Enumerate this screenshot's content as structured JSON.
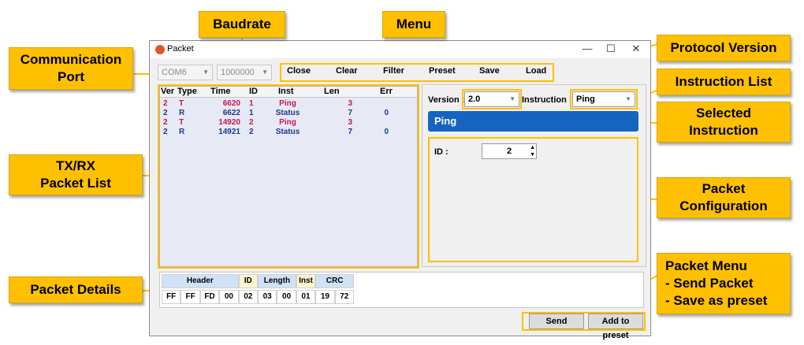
{
  "callouts": {
    "comm_port": "Communication\nPort",
    "baudrate": "Baudrate",
    "menu": "Menu",
    "protocol_version": "Protocol Version",
    "instruction_list": "Instruction List",
    "selected_instruction": "Selected\nInstruction",
    "txrx_list": "TX/RX\nPacket List",
    "packet_configuration": "Packet\nConfiguration",
    "packet_details": "Packet Details",
    "packet_menu": "Packet Menu\n - Send Packet\n - Save as preset"
  },
  "window": {
    "title": "Packet",
    "minimize": "—",
    "maximize": "☐",
    "close": "✕"
  },
  "toolbar": {
    "port": "COM6",
    "baud": "1000000",
    "menu": [
      "Close",
      "Clear",
      "Filter",
      "Preset",
      "Save",
      "Load"
    ]
  },
  "packet_list": {
    "columns": [
      "Ver",
      "Type",
      "Time",
      "ID",
      "Inst",
      "Len",
      "Err"
    ],
    "rows": [
      {
        "ver": "2",
        "type": "T",
        "time": "6620",
        "id": "1",
        "inst": "Ping",
        "len": "3",
        "err": ""
      },
      {
        "ver": "2",
        "type": "R",
        "time": "6622",
        "id": "1",
        "inst": "Status",
        "len": "7",
        "err": "0"
      },
      {
        "ver": "2",
        "type": "T",
        "time": "14920",
        "id": "2",
        "inst": "Ping",
        "len": "3",
        "err": ""
      },
      {
        "ver": "2",
        "type": "R",
        "time": "14921",
        "id": "2",
        "inst": "Status",
        "len": "7",
        "err": "0"
      }
    ],
    "colors": {
      "T": "#c0185a",
      "R": "#1a3a8a"
    }
  },
  "config": {
    "version_label": "Version :",
    "version_value": "2.0",
    "instruction_label": "Instruction :",
    "instruction_value": "Ping",
    "selected_instruction": "Ping",
    "id_label": "ID :",
    "id_value": "2"
  },
  "details": {
    "groups": [
      "Header",
      "ID",
      "Length",
      "Inst",
      "CRC"
    ],
    "bytes": [
      "FF",
      "FF",
      "FD",
      "00",
      "02",
      "03",
      "00",
      "01",
      "19",
      "72"
    ]
  },
  "actions": {
    "send": "Send",
    "add_preset": "Add to preset"
  },
  "colors": {
    "accent": "#fec000",
    "selected_bar": "#1565c0",
    "header_blue": "#cfe2f7",
    "header_yellow": "#fef6cc"
  }
}
